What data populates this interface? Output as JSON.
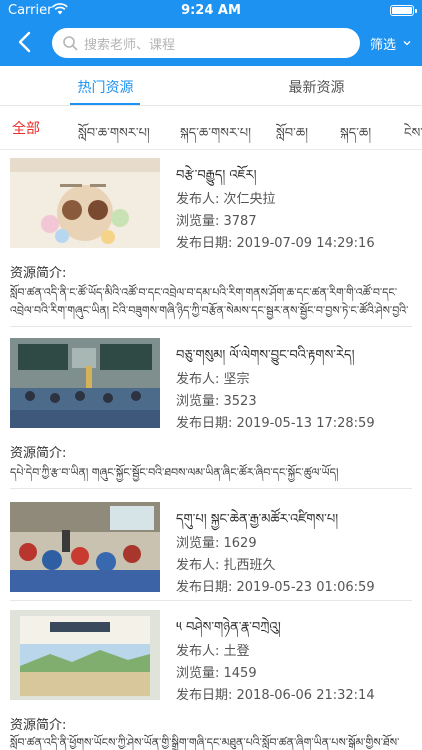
{
  "status": {
    "carrier": "Carrier",
    "time": "9:24 AM"
  },
  "search": {
    "placeholder": "搜索老师、课程"
  },
  "filter": {
    "label": "筛选"
  },
  "tabs": [
    {
      "label": "热门资源"
    },
    {
      "label": "最新资源"
    }
  ],
  "categories": [
    "全部",
    "སློབ་ཆ་གསར་པ།",
    "སྐད་ཆ་གསར་པ།",
    "སློབ་ཆ།",
    "སྐད་ཆ།",
    "ངེས་"
  ],
  "labels": {
    "publisher": "发布人: ",
    "views": "浏览量: ",
    "date": "发布日期: ",
    "desc": "资源简介:"
  },
  "items": [
    {
      "title": "བརྩེ་བརྒྱུད།    འཇོར།",
      "publisher": "次仁央拉",
      "views": "3787",
      "date": "2019-07-09 14:29:16",
      "desc": "སློབ་ཚན་འདི་ནི་ང་ཚོ་ཡོད་མིའི་འཚོ་བ་དང་འབྲེལ་བ་དམ་པའི་རིག་གནས་ཤོག་ཆ་དང་ཚན་རིག་གི་འཚོ་བ་དང་འབྲེལ་བའི་རིག་གཞུང་ཡིན།  ངེའི་བཟུགས་གཞི་ཉིད་ཀྱི་བརྩོན་སེམས་དང་སྦྱར་ནས་སྦྱོང་བ་བྱས་ཏེ་ང་ཚོའི་ཤེས་བྱའི་རིག་གནས་ལ་སྦྱང་།"
    },
    {
      "title": "བཅུ་གསུམ།    ལོ་ལེགས་བྱུང་བའི་རྟགས་རེད།",
      "publisher": "坚宗",
      "views": "3523",
      "date": "2019-05-13 17:28:59",
      "desc": "དཔེ་དེབ་ཀྱི་རྩ་བ་ཡིན། གཞུང་སྐྱོང་སྦྱོང་བའི་ཐབས་ལམ་ཡིན་ཞིང་ཚོར་ཞིབ་དང་སྐྱོང་ཚུལ་ཡོད།"
    },
    {
      "title": "དགུ་པ།    སྐྱང་ཆེན་རྒྱ་མཚོར་འཛིགས་པ།",
      "publisher": "扎西班久",
      "views": "1629",
      "date": "2019-05-23 01:06:59",
      "desc": ""
    },
    {
      "title": "༥  བཤེས་གཉེན་རྣ་བཀྲེའུ།",
      "publisher": "土登",
      "views": "1459",
      "date": "2018-06-06 21:32:14",
      "desc": "སློབ་ཚན་འདི་ནི་ཕྱོགས་ཡོངས་ཀྱི་ཤེས་ཡོན་གྱི་སྒྲིག་གཞི་དང་མཐུན་པའི་སློབ་ཚན་ཞིག་ཡིན་པས་སྒོམ་གྱིས་ཐོས་པར་བྱ།"
    }
  ]
}
